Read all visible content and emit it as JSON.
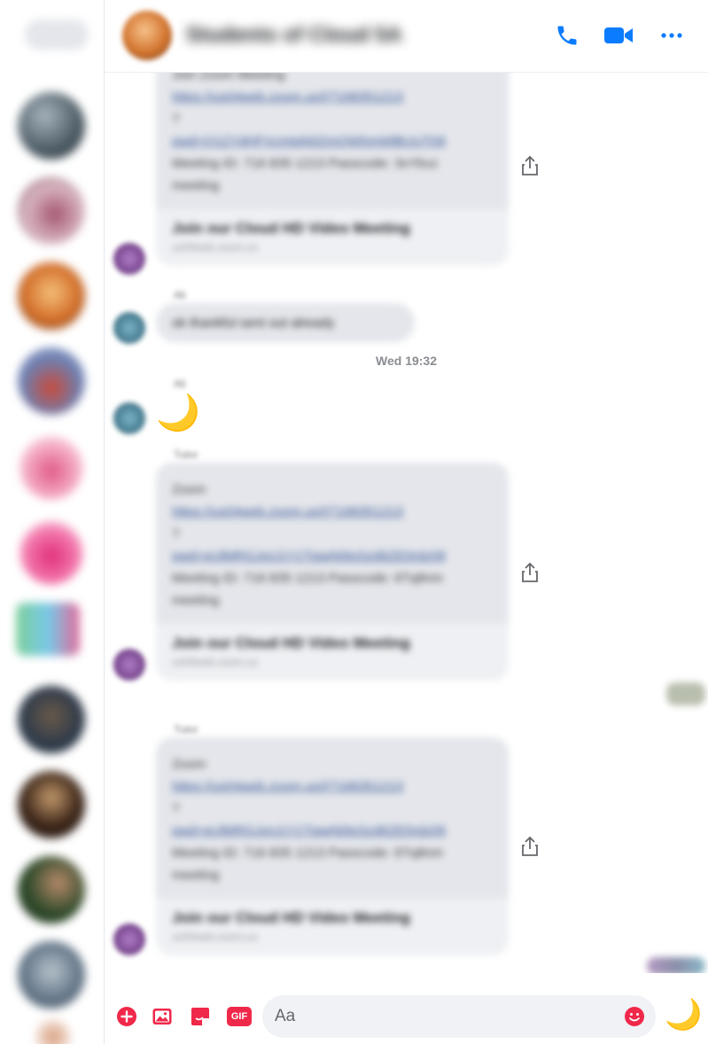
{
  "header": {
    "conversation_name": "Students of Cloud 5A",
    "icons": [
      "phone-icon",
      "video-camera-icon",
      "more-options-icon"
    ],
    "accent_color": "#0a7cff"
  },
  "rail": {
    "search_placeholder": "",
    "avatar_count": 11
  },
  "messages": {
    "timestamp_divider": "Wed 19:32",
    "cards": [
      {
        "sender": "",
        "lines": [
          "Join Zoom Meeting",
          "https://us04web.zoom.us/j/7168351213",
          "?",
          "pwd=Q1ZYdHFVcmtqN0ZmQWhmWlBUUT09",
          "Meeting ID: 716 835 1213 Passcode: 3xYbvz",
          "meeting"
        ],
        "foot_title": "Join our Cloud HD Video Meeting",
        "foot_sub": "us04web.zoom.us"
      },
      {
        "sender": "Tutor",
        "lines": [
          "Zoom",
          "https://us04web.zoom.us/j/7168351213",
          "?",
          "pwd=eUlMRGJoU1Y1TjgwN0tsSzd6ZE0rdz09",
          "Meeting ID: 716 835 1213 Passcode: 6Tq8nm",
          "meeting"
        ],
        "foot_title": "Join our Cloud HD Video Meeting",
        "foot_sub": "us04web.zoom.us"
      },
      {
        "sender": "Tutor",
        "lines": [
          "Zoom",
          "https://us04web.zoom.us/j/7168351213",
          "?",
          "pwd=eUlMRGJoU1Y1TjgwN0tsSzd6ZE0rdz09",
          "Meeting ID: 716 835 1213 Passcode: 6Tq8nm",
          "meeting"
        ],
        "foot_title": "Join our Cloud HD Video Meeting",
        "foot_sub": "us04web.zoom.us"
      }
    ],
    "text_message": {
      "sender": "Ali",
      "text": "ok thankful sent out already"
    },
    "emoji_message": {
      "sender": "Ali",
      "emoji": "🌙"
    }
  },
  "composer": {
    "placeholder": "Aa",
    "gif_label": "GIF",
    "like_emoji": "🌙",
    "accent_color": "#f02849"
  }
}
